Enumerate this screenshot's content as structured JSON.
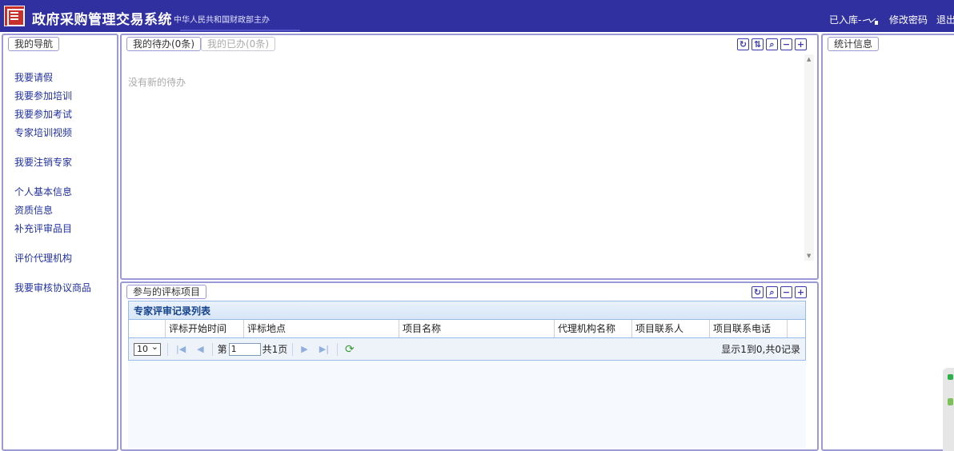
{
  "header": {
    "title": "政府采购管理交易系统",
    "subtitle": "中华人民共和国财政部主办",
    "user_label": "已入库-",
    "change_password": "修改密码",
    "logout": "退出"
  },
  "nav": {
    "tab": "我的导航",
    "groups": [
      [
        "我要请假",
        "我要参加培训",
        "我要参加考试",
        "专家培训视频"
      ],
      [
        "我要注销专家"
      ],
      [
        "个人基本信息",
        "资质信息",
        "补充评审品目"
      ],
      [
        "评价代理机构"
      ],
      [
        "我要审核协议商品"
      ]
    ]
  },
  "todo": {
    "tab_active": "我的待办(0条)",
    "tab_inactive": "我的已办(0条)",
    "empty_text": "没有新的待办"
  },
  "projects": {
    "tab": "参与的评标项目",
    "grid_title": "专家评审记录列表",
    "columns": [
      "",
      "评标开始时间",
      "评标地点",
      "项目名称",
      "代理机构名称",
      "项目联系人",
      "项目联系电话"
    ],
    "page_size": "10",
    "page_prefix": "第",
    "page_value": "1",
    "page_total": "共1页",
    "record_info": "显示1到0,共0记录"
  },
  "stats": {
    "tab": "统计信息"
  },
  "colors": {
    "header_bg": "#3130a0",
    "panel_border": "#9c9ad6",
    "nav_link": "#2030a0",
    "grid_title": "#15428b"
  }
}
